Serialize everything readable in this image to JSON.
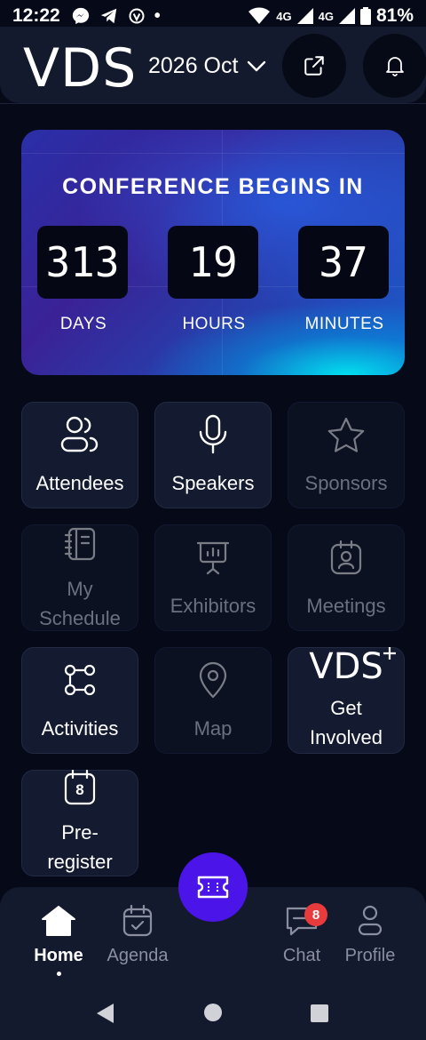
{
  "status_bar": {
    "time": "12:22",
    "network_labels": [
      "4G",
      "4G"
    ],
    "battery": "81%"
  },
  "header": {
    "brand": "VDS",
    "edition": "2026 Oct",
    "external_link_icon": "external-link-icon",
    "notifications_icon": "bell-icon"
  },
  "countdown": {
    "title": "CONFERENCE BEGINS IN",
    "units": [
      {
        "value": "313",
        "label": "DAYS"
      },
      {
        "value": "19",
        "label": "HOURS"
      },
      {
        "value": "37",
        "label": "MINUTES"
      }
    ]
  },
  "tiles": [
    {
      "label": "Attendees",
      "icon": "users-icon",
      "enabled": true
    },
    {
      "label": "Speakers",
      "icon": "microphone-icon",
      "enabled": true
    },
    {
      "label": "Sponsors",
      "icon": "star-icon",
      "enabled": false
    },
    {
      "label": "My Schedule",
      "icon": "notebook-icon",
      "enabled": false
    },
    {
      "label": "Exhibitors",
      "icon": "presentation-icon",
      "enabled": false
    },
    {
      "label": "Meetings",
      "icon": "badge-icon",
      "enabled": false
    },
    {
      "label": "Activities",
      "icon": "route-icon",
      "enabled": true
    },
    {
      "label": "Map",
      "icon": "map-pin-icon",
      "enabled": false
    },
    {
      "label": "Get Involved",
      "logo": "VDS",
      "icon": "vds-logo",
      "enabled": true
    },
    {
      "label": "Pre-register",
      "icon": "calendar-icon",
      "calendar_day": "8",
      "enabled": true
    }
  ],
  "fab": {
    "icon": "ticket-icon"
  },
  "bottom_nav": {
    "items": [
      {
        "label": "Home",
        "icon": "home-icon",
        "active": true
      },
      {
        "label": "Agenda",
        "icon": "calendar-check-icon",
        "active": false
      },
      {
        "label": "Chat",
        "icon": "chat-icon",
        "badge": "8",
        "active": false
      },
      {
        "label": "Profile",
        "icon": "user-icon",
        "active": false
      }
    ]
  },
  "colors": {
    "background": "#060a18",
    "surface": "#141a2e",
    "accent": "#4b14e8",
    "badge": "#e83c3c",
    "dim_text": "#6b7080"
  }
}
